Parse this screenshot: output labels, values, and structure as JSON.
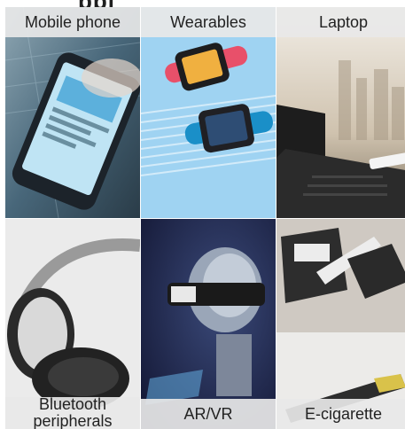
{
  "heading_fragment": "ppl",
  "categories": [
    {
      "label": "Mobile phone"
    },
    {
      "label": "Wearables"
    },
    {
      "label": "Laptop"
    },
    {
      "label": "Bluetooth peripherals"
    },
    {
      "label": "AR/VR"
    },
    {
      "label": "E-cigarette"
    }
  ],
  "colors": {
    "label_bg": "#e8e8e8",
    "text": "#222222",
    "mobile_bg": "#3f5e70",
    "wearables_bg": "#9fd3f2",
    "laptop_bg": "#d8d0c4",
    "bluetooth_bg": "#e9e9e9",
    "arvr_bg": "#1c2144",
    "ecig_bg": "#cfc9c2"
  }
}
